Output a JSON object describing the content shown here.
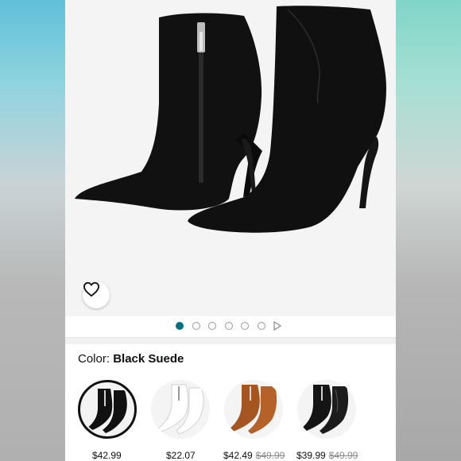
{
  "product": {
    "image_alt": "Black suede pointed-toe stiletto ankle boots",
    "favorite_icon": "heart-outline-icon"
  },
  "carousel": {
    "dot_count": 6,
    "active_index": 0,
    "play_icon": "play-triangle-icon",
    "active_color": "#007185"
  },
  "color_selector": {
    "label": "Color:",
    "selected_value": "Black Suede",
    "options": [
      {
        "name": "black-suede",
        "price": "$42.99",
        "original_price": "",
        "selected": true
      },
      {
        "name": "white",
        "price": "$22.07",
        "original_price": "",
        "selected": false
      },
      {
        "name": "brown",
        "price": "$42.49",
        "original_price": "$49.99",
        "selected": false
      },
      {
        "name": "black-leather",
        "price": "$39.99",
        "original_price": "$49.99",
        "selected": false
      }
    ]
  }
}
